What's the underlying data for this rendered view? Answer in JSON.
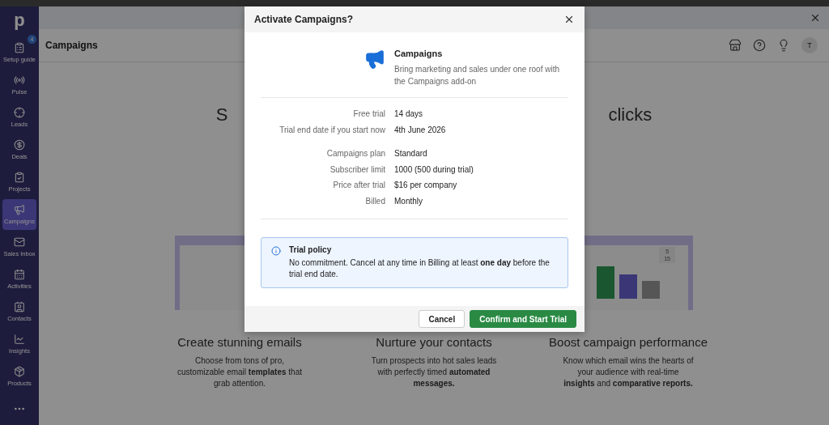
{
  "sidebar": {
    "logo": "p",
    "items": [
      {
        "label": "Setup guide",
        "badge": "4",
        "selected": false
      },
      {
        "label": "Pulse",
        "selected": false
      },
      {
        "label": "Leads",
        "selected": false
      },
      {
        "label": "Deals",
        "selected": false
      },
      {
        "label": "Projects",
        "selected": false
      },
      {
        "label": "Campaigns",
        "selected": true
      },
      {
        "label": "Sales Inbox",
        "selected": false
      },
      {
        "label": "Activities",
        "selected": false
      },
      {
        "label": "Contacts",
        "selected": false
      },
      {
        "label": "Insights",
        "selected": false
      },
      {
        "label": "Products",
        "selected": false
      }
    ]
  },
  "header": {
    "title": "Campaigns",
    "avatar": "T"
  },
  "hero": {
    "heading_start": "S",
    "heading_end": "clicks"
  },
  "features": [
    {
      "title": "Create stunning emails",
      "body": "Choose from tons of pro, customizable email **templates** that grab attention."
    },
    {
      "title": "Nurture your contacts",
      "body": "Turn prospects into hot sales leads with perfectly timed **automated messages.**"
    },
    {
      "title": "Boost campaign performance",
      "body": "Know which email wins the hearts of your audience with real-time **insights** and **comparative reports.**"
    }
  ],
  "illustration_counts": [
    "5",
    "15"
  ],
  "modal": {
    "title": "Activate Campaigns?",
    "product": "Campaigns",
    "description": "Bring marketing and sales under one roof with the Campaigns add-on",
    "detail_groups": [
      [
        {
          "label": "Free trial",
          "value": "14 days"
        },
        {
          "label": "Trial end date if you start now",
          "value": "4th June 2026"
        }
      ],
      [
        {
          "label": "Campaigns plan",
          "value": "Standard"
        },
        {
          "label": "Subscriber limit",
          "value": "1000 (500 during trial)"
        },
        {
          "label": "Price after trial",
          "value": "$16 per company"
        },
        {
          "label": "Billed",
          "value": "Monthly"
        }
      ]
    ],
    "policy": {
      "title": "Trial policy",
      "text": "No commitment. Cancel at any time in Billing at least **one day** before the trial end date."
    },
    "buttons": [
      {
        "kind": "secondary",
        "label": "Cancel"
      },
      {
        "kind": "primary",
        "label": "Confirm and Start Trial"
      }
    ]
  }
}
